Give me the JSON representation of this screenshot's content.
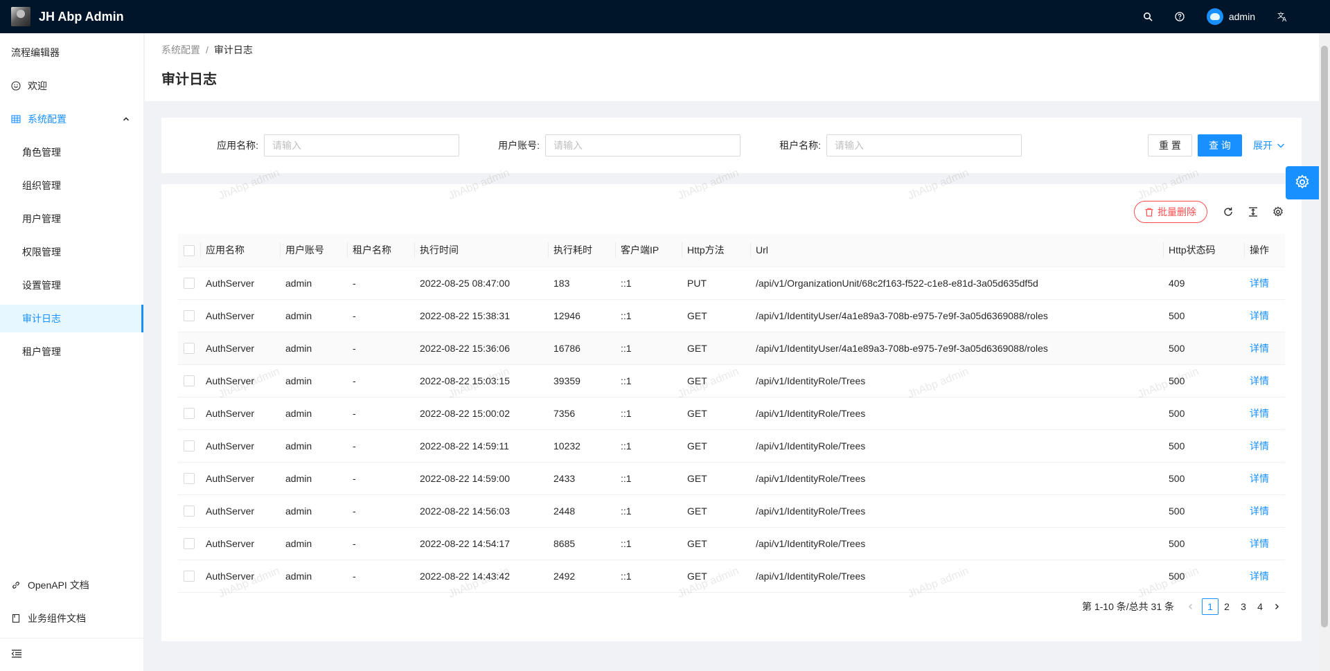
{
  "app": {
    "title": "JH Abp Admin"
  },
  "header": {
    "user": "admin",
    "icons": [
      "search-icon",
      "question-icon",
      "translate-icon"
    ]
  },
  "sidebar": {
    "items": [
      {
        "label": "流程编辑器"
      },
      {
        "label": "欢迎",
        "icon": "smile-icon"
      },
      {
        "label": "系统配置",
        "icon": "table-icon"
      },
      {
        "label": "角色管理"
      },
      {
        "label": "组织管理"
      },
      {
        "label": "用户管理"
      },
      {
        "label": "权限管理"
      },
      {
        "label": "设置管理"
      },
      {
        "label": "审计日志"
      },
      {
        "label": "租户管理"
      }
    ],
    "bottom": [
      {
        "label": "OpenAPI 文档",
        "icon": "link-icon"
      },
      {
        "label": "业务组件文档",
        "icon": "book-icon"
      }
    ]
  },
  "breadcrumb": {
    "parent": "系统配置",
    "current": "审计日志",
    "sep": "/"
  },
  "page_title": "审计日志",
  "search": {
    "app_label": "应用名称:",
    "user_label": "用户账号:",
    "tenant_label": "租户名称:",
    "placeholder": "请输入",
    "reset": "重 置",
    "query": "查 询",
    "expand": "展开"
  },
  "toolbar": {
    "batch_delete": "批量删除"
  },
  "table": {
    "columns": [
      "应用名称",
      "用户账号",
      "租户名称",
      "执行时间",
      "执行耗时",
      "客户端IP",
      "Http方法",
      "Url",
      "Http状态码",
      "操作"
    ],
    "rows": [
      [
        "AuthServer",
        "admin",
        "-",
        "2022-08-25 08:47:00",
        "183",
        "::1",
        "PUT",
        "/api/v1/OrganizationUnit/68c2f163-f522-c1e8-e81d-3a05d635df5d",
        "409",
        "详情"
      ],
      [
        "AuthServer",
        "admin",
        "-",
        "2022-08-22 15:38:31",
        "12946",
        "::1",
        "GET",
        "/api/v1/IdentityUser/4a1e89a3-708b-e975-7e9f-3a05d6369088/roles",
        "500",
        "详情"
      ],
      [
        "AuthServer",
        "admin",
        "-",
        "2022-08-22 15:36:06",
        "16786",
        "::1",
        "GET",
        "/api/v1/IdentityUser/4a1e89a3-708b-e975-7e9f-3a05d6369088/roles",
        "500",
        "详情"
      ],
      [
        "AuthServer",
        "admin",
        "-",
        "2022-08-22 15:03:15",
        "39359",
        "::1",
        "GET",
        "/api/v1/IdentityRole/Trees",
        "500",
        "详情"
      ],
      [
        "AuthServer",
        "admin",
        "-",
        "2022-08-22 15:00:02",
        "7356",
        "::1",
        "GET",
        "/api/v1/IdentityRole/Trees",
        "500",
        "详情"
      ],
      [
        "AuthServer",
        "admin",
        "-",
        "2022-08-22 14:59:11",
        "10232",
        "::1",
        "GET",
        "/api/v1/IdentityRole/Trees",
        "500",
        "详情"
      ],
      [
        "AuthServer",
        "admin",
        "-",
        "2022-08-22 14:59:00",
        "2433",
        "::1",
        "GET",
        "/api/v1/IdentityRole/Trees",
        "500",
        "详情"
      ],
      [
        "AuthServer",
        "admin",
        "-",
        "2022-08-22 14:56:03",
        "2448",
        "::1",
        "GET",
        "/api/v1/IdentityRole/Trees",
        "500",
        "详情"
      ],
      [
        "AuthServer",
        "admin",
        "-",
        "2022-08-22 14:54:17",
        "8685",
        "::1",
        "GET",
        "/api/v1/IdentityRole/Trees",
        "500",
        "详情"
      ],
      [
        "AuthServer",
        "admin",
        "-",
        "2022-08-22 14:43:42",
        "2492",
        "::1",
        "GET",
        "/api/v1/IdentityRole/Trees",
        "500",
        "详情"
      ]
    ]
  },
  "pagination": {
    "total_text": "第 1-10 条/总共 31 条",
    "pages": [
      "1",
      "2",
      "3",
      "4"
    ],
    "current": "1"
  },
  "watermark": "JhAbp admin",
  "colors": {
    "primary": "#1890ff",
    "header_bg": "#001529",
    "danger": "#ff4d4f"
  }
}
